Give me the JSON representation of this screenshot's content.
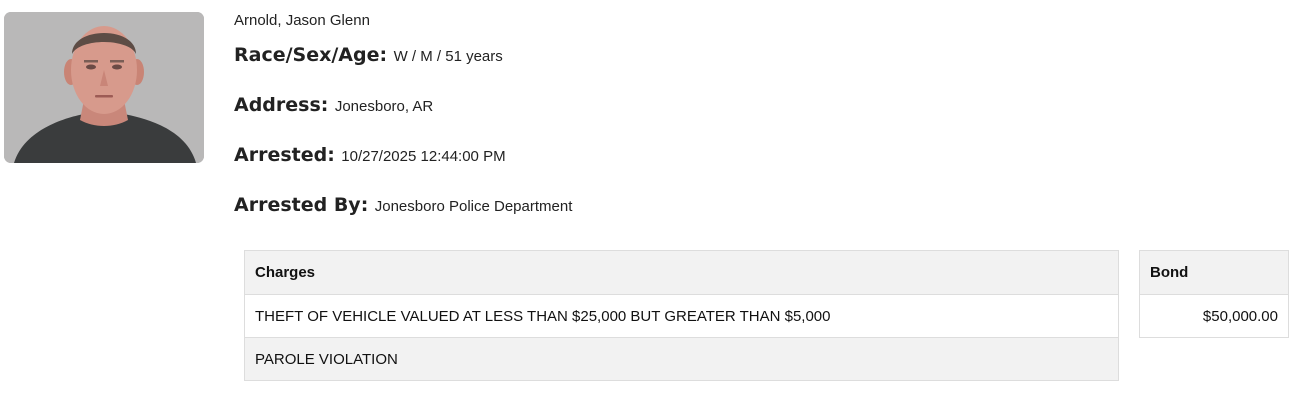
{
  "inmate": {
    "name": "Arnold, Jason Glenn",
    "fields": [
      {
        "label": "Race/Sex/Age:",
        "value": "W / M / 51 years"
      },
      {
        "label": "Address:",
        "value": "Jonesboro, AR"
      },
      {
        "label": "Arrested:",
        "value": "10/27/2025 12:44:00 PM"
      },
      {
        "label": "Arrested By:",
        "value": "Jonesboro Police Department"
      }
    ]
  },
  "charges": {
    "header": "Charges",
    "rows": [
      "THEFT OF VEHICLE VALUED AT LESS THAN $25,000 BUT GREATER THAN $5,000",
      "PAROLE VIOLATION"
    ]
  },
  "bond": {
    "header": "Bond",
    "rows": [
      "$50,000.00"
    ]
  },
  "colors": {
    "table_header_bg": "#f2f2f2",
    "table_border": "#dddddd",
    "text": "#222222"
  }
}
